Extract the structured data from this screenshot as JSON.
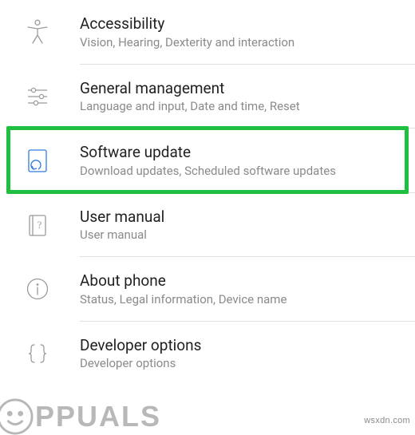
{
  "settings": {
    "items": [
      {
        "id": "accessibility",
        "title": "Accessibility",
        "subtitle": "Vision, Hearing, Dexterity and interaction",
        "icon": "accessibility-icon",
        "highlighted": false
      },
      {
        "id": "general-management",
        "title": "General management",
        "subtitle": "Language and input, Date and time, Reset",
        "icon": "sliders-icon",
        "highlighted": false
      },
      {
        "id": "software-update",
        "title": "Software update",
        "subtitle": "Download updates, Scheduled software updates",
        "icon": "update-icon",
        "highlighted": true
      },
      {
        "id": "user-manual",
        "title": "User manual",
        "subtitle": "User manual",
        "icon": "book-icon",
        "highlighted": false
      },
      {
        "id": "about-phone",
        "title": "About phone",
        "subtitle": "Status, Legal information, Device name",
        "icon": "info-icon",
        "highlighted": false
      },
      {
        "id": "developer-options",
        "title": "Developer options",
        "subtitle": "Developer options",
        "icon": "braces-icon",
        "highlighted": false
      }
    ]
  },
  "annotation": {
    "highlight_color": "#1fbf3f",
    "highlighted_item_index": 2
  },
  "watermark": {
    "text": "PPUALS",
    "source": "wsxdn.com"
  }
}
